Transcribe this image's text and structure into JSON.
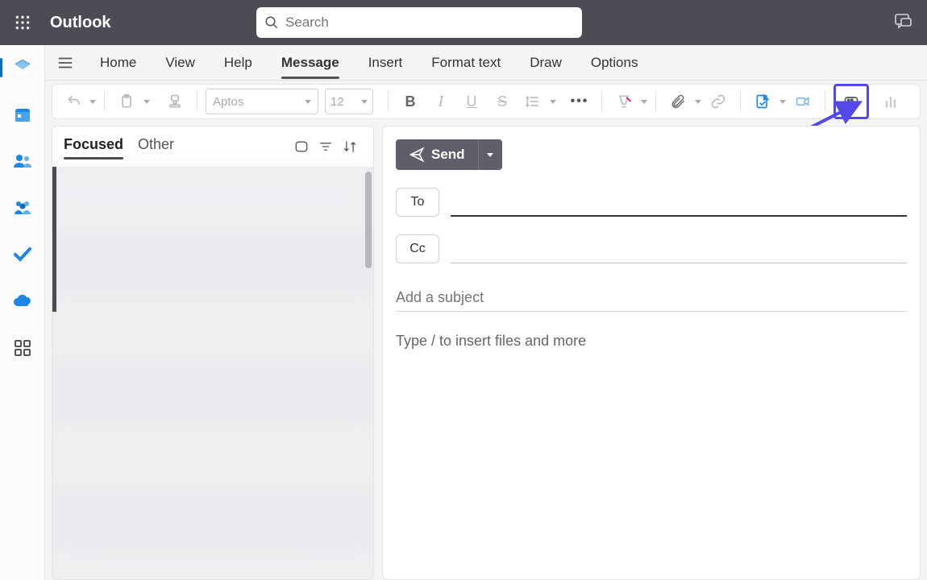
{
  "app": {
    "name": "Outlook"
  },
  "search": {
    "placeholder": "Search"
  },
  "ribbon": {
    "tabs": [
      "Home",
      "View",
      "Help",
      "Message",
      "Insert",
      "Format text",
      "Draw",
      "Options"
    ],
    "active_tab_index": 3,
    "font_name": "Aptos",
    "font_size": "12"
  },
  "message_list": {
    "tabs": [
      "Focused",
      "Other"
    ],
    "active_tab_index": 0
  },
  "compose": {
    "send_label": "Send",
    "to_label": "To",
    "cc_label": "Cc",
    "to_value": "",
    "cc_value": "",
    "subject_placeholder": "Add a subject",
    "body_placeholder": "Type / to insert files and more"
  },
  "rail": {
    "items": [
      "mail",
      "calendar",
      "people",
      "groups",
      "todo",
      "onedrive",
      "apps"
    ],
    "active_index": 0
  },
  "annotation": {
    "target": "apps-toolbar-button"
  }
}
